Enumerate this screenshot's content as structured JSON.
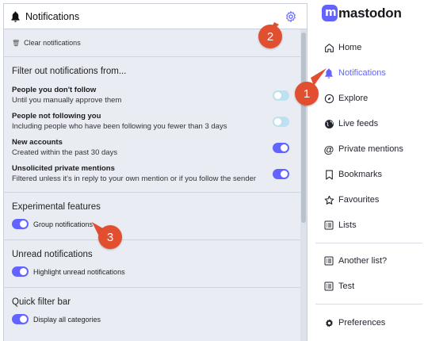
{
  "panel": {
    "title": "Notifications",
    "clear_label": "Clear notifications"
  },
  "filter": {
    "title": "Filter out notifications from...",
    "options": [
      {
        "label": "People you don't follow",
        "hint": "Until you manually approve them",
        "enabled": false
      },
      {
        "label": "People not following you",
        "hint": "Including people who have been following you fewer than 3 days",
        "enabled": false
      },
      {
        "label": "New accounts",
        "hint": "Created within the past 30 days",
        "enabled": true
      },
      {
        "label": "Unsolicited private mentions",
        "hint": "Filtered unless it's in reply to your own mention or if you follow the sender",
        "enabled": true
      }
    ]
  },
  "experimental": {
    "title": "Experimental features",
    "option_label": "Group notifications",
    "enabled": true
  },
  "unread": {
    "title": "Unread notifications",
    "option_label": "Highlight unread notifications",
    "enabled": true
  },
  "quick_filter": {
    "title": "Quick filter bar",
    "option_label": "Display all categories",
    "enabled": true
  },
  "nav": {
    "brand": "mastodon",
    "items": [
      {
        "label": "Home",
        "icon": "home-icon"
      },
      {
        "label": "Notifications",
        "icon": "bell-icon",
        "active": true
      },
      {
        "label": "Explore",
        "icon": "compass-icon"
      },
      {
        "label": "Live feeds",
        "icon": "globe-icon"
      },
      {
        "label": "Private mentions",
        "icon": "at-icon"
      },
      {
        "label": "Bookmarks",
        "icon": "bookmark-icon"
      },
      {
        "label": "Favourites",
        "icon": "star-icon"
      },
      {
        "label": "Lists",
        "icon": "list-icon"
      },
      {
        "label": "Another list?",
        "icon": "list-icon"
      },
      {
        "label": "Test",
        "icon": "list-icon"
      },
      {
        "label": "Preferences",
        "icon": "gear-icon"
      }
    ]
  },
  "callouts": [
    "1",
    "2",
    "3"
  ],
  "colors": {
    "accent": "#6364ff",
    "callout": "#e24e30",
    "toggle_off": "#bfe0f0"
  }
}
